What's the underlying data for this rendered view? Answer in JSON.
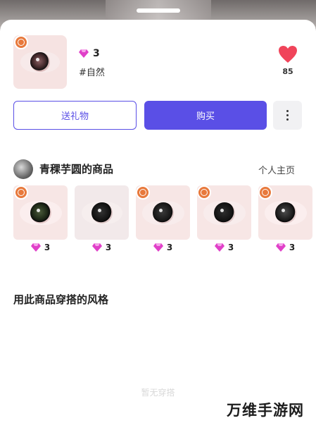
{
  "item": {
    "price": "3",
    "tag": "#自然",
    "like_count": "85"
  },
  "actions": {
    "gift_label": "送礼物",
    "buy_label": "购买"
  },
  "shop": {
    "name": "青稞芋圆的商品",
    "profile_link": "个人主页",
    "products": [
      {
        "price": "3"
      },
      {
        "price": "3"
      },
      {
        "price": "3"
      },
      {
        "price": "3"
      },
      {
        "price": "3"
      }
    ]
  },
  "styles_section": {
    "title": "用此商品穿搭的风格",
    "empty_text": "暂无穿搭"
  },
  "watermark": "万维手游网",
  "colors": {
    "accent": "#5a4fe6",
    "heart": "#f0445a",
    "badge": "#e8793c",
    "gem": "#e040c8"
  },
  "icons": [
    "copyright-badge-icon",
    "gem-icon",
    "heart-icon",
    "more-icon"
  ]
}
